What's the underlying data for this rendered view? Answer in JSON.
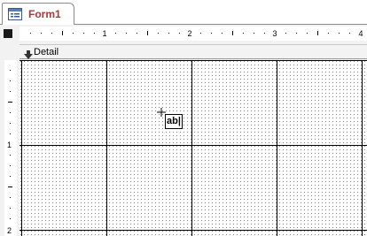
{
  "tab": {
    "label": "Form1",
    "icon": "form-icon"
  },
  "ruler": {
    "horizontal_marks": [
      "1",
      "2",
      "3",
      "4"
    ],
    "vertical_marks": [
      "1",
      "2"
    ]
  },
  "section": {
    "label": "Detail",
    "icon": "collapse-arrow-icon"
  },
  "pointer": {
    "cursor_icon": "crosshair-icon",
    "tool_label": "ab|"
  },
  "colors": {
    "tab_text": "#a33a3a",
    "grid_line": "#000000",
    "grid_dot": "#7f7f7f"
  }
}
